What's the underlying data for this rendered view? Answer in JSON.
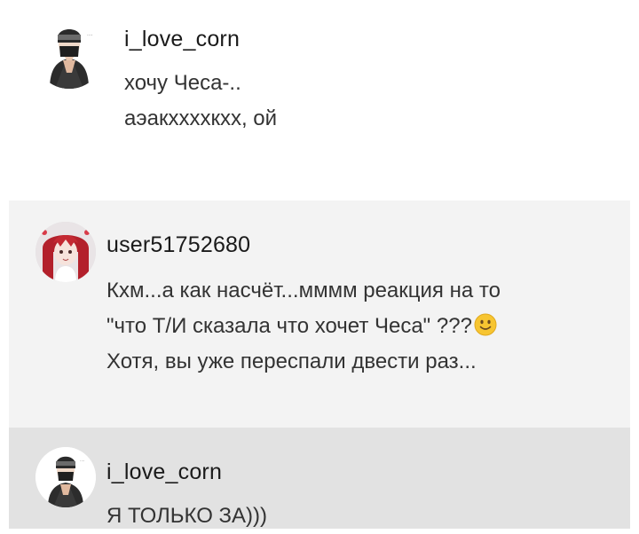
{
  "comments": [
    {
      "username": "i_love_corn",
      "avatar_icon": "masked-ninja-avatar-icon",
      "lines": [
        "хочу Чеса-..",
        "аэакххххкхх, ой"
      ]
    },
    {
      "username": "user51752680",
      "avatar_icon": "red-hair-anime-girl-avatar-icon",
      "lines": [
        "Кхм...а как насчёт...мммм реакция на то",
        "\"что Т/И сказала что хочет Чеса\" ???",
        "Хотя, вы уже переспали двести раз..."
      ],
      "emoji": "slightly-smiling-face-icon"
    },
    {
      "username": "i_love_corn",
      "avatar_icon": "masked-ninja-avatar-icon",
      "lines": [
        "Я ТОЛЬКО ЗА)))"
      ]
    }
  ],
  "colors": {
    "background": "#ffffff",
    "comment2_bg": "#f3f3f3",
    "comment3_bg": "#e2e2e2",
    "text": "#333333",
    "emoji": "#f7c531"
  }
}
